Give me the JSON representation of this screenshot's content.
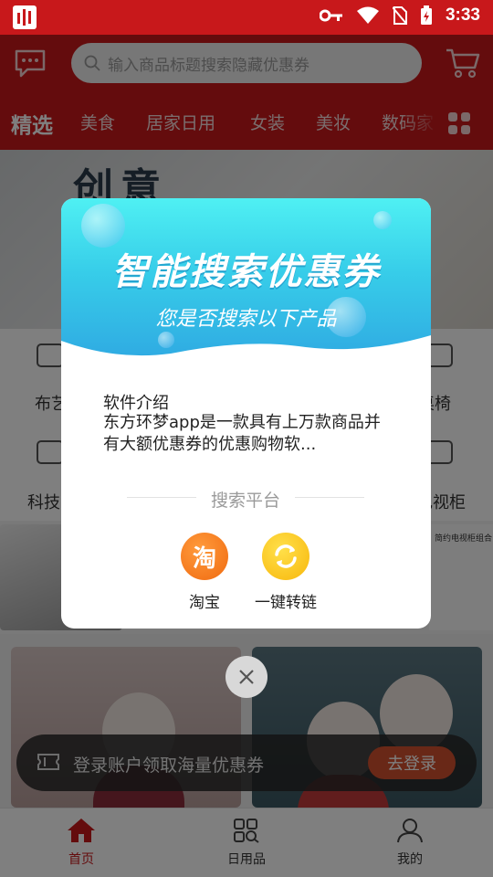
{
  "status_bar": {
    "time": "3:33"
  },
  "header": {
    "search_placeholder": "输入商品标题搜索隐藏优惠券"
  },
  "tabs": [
    {
      "label": "精选",
      "active": true
    },
    {
      "label": "美食"
    },
    {
      "label": "居家日用"
    },
    {
      "label": "女装"
    },
    {
      "label": "美妆"
    },
    {
      "label": "数码家"
    }
  ],
  "background": {
    "banner_text": "创意",
    "categories": [
      "布艺",
      "桌椅",
      "科技",
      "电视柜"
    ],
    "product_label": "简约电视柜组合"
  },
  "dialog": {
    "title": "智能搜索优惠券",
    "subtitle": "您是否搜索以下产品",
    "intro_title": "软件介绍",
    "intro_body": "东方环梦app是一款具有上万款商品并有大额优惠券的优惠购物软...",
    "platform_label": "搜索平台",
    "platforms": [
      {
        "name": "淘宝",
        "glyph": "淘",
        "icon": "taobao-icon",
        "color": "#f27a1a"
      },
      {
        "name": "一键转链",
        "icon": "convert-link-icon",
        "color": "#f8c21a"
      }
    ]
  },
  "login_toast": {
    "text": "登录账户领取海量优惠券",
    "button": "去登录"
  },
  "bottom_nav": [
    {
      "label": "首页",
      "icon": "home-icon",
      "active": true
    },
    {
      "label": "日用品",
      "icon": "grid-search-icon"
    },
    {
      "label": "我的",
      "icon": "user-icon"
    }
  ],
  "colors": {
    "brand_red": "#c8181b",
    "dialog_cyan": "#37cde9",
    "login_orange": "#d2502e"
  }
}
